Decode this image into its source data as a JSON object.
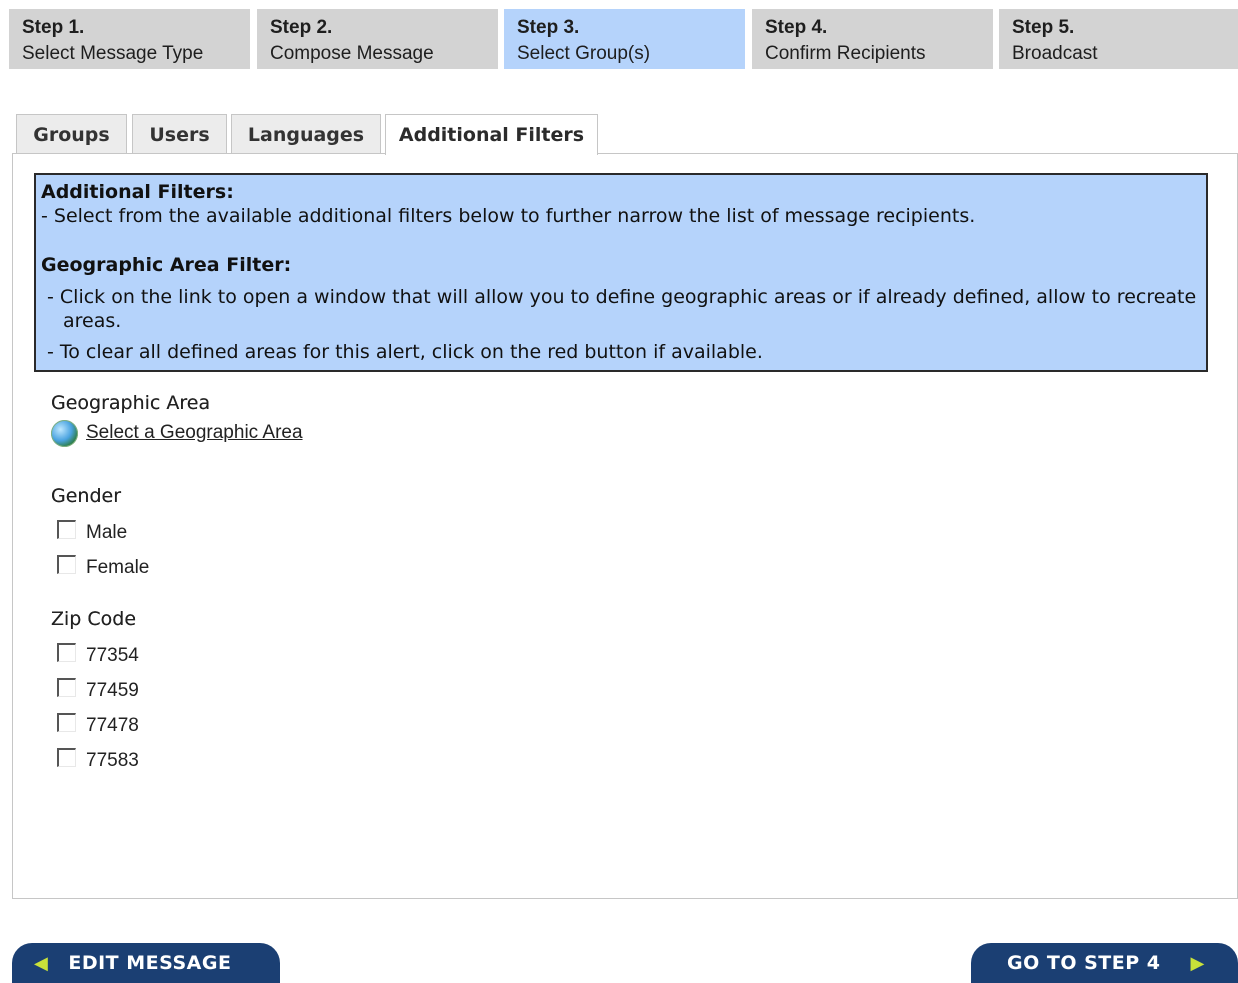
{
  "steps": [
    {
      "num": "Step 1.",
      "label": "Select Message Type",
      "active": false
    },
    {
      "num": "Step 2.",
      "label": "Compose Message",
      "active": false
    },
    {
      "num": "Step 3.",
      "label": "Select Group(s)",
      "active": true
    },
    {
      "num": "Step 4.",
      "label": "Confirm Recipients",
      "active": false
    },
    {
      "num": "Step 5.",
      "label": "Broadcast",
      "active": false
    }
  ],
  "tabs": [
    {
      "label": "Groups",
      "active": false
    },
    {
      "label": "Users",
      "active": false
    },
    {
      "label": "Languages",
      "active": false
    },
    {
      "label": "Additional Filters",
      "active": true
    }
  ],
  "info": {
    "title": "Additional Filters:",
    "desc": "- Select from the available additional filters below to further narrow the list of message recipients.",
    "geo_title": "Geographic Area Filter:",
    "geo_line1": "- Click on the link to open a window that will allow you to define geographic areas or if already defined, allow to recreate areas.",
    "geo_line2": "- To clear all defined areas for this alert, click on the red button if available."
  },
  "geographic": {
    "title": "Geographic Area",
    "link_label": "Select a Geographic Area",
    "icon": "globe-icon"
  },
  "gender": {
    "title": "Gender",
    "options": [
      {
        "label": "Male",
        "checked": false
      },
      {
        "label": "Female",
        "checked": false
      }
    ]
  },
  "zip": {
    "title": "Zip Code",
    "options": [
      {
        "label": "77354",
        "checked": false
      },
      {
        "label": "77459",
        "checked": false
      },
      {
        "label": "77478",
        "checked": false
      },
      {
        "label": "77583",
        "checked": false
      }
    ]
  },
  "buttons": {
    "back_label": "EDIT MESSAGE",
    "next_label": "GO TO STEP 4",
    "back_icon": "arrow-left-icon",
    "next_icon": "arrow-right-icon"
  },
  "colors": {
    "active_step": "#b5d3fb",
    "inactive_step": "#d3d3d3",
    "info_box": "#b5d3fb",
    "button": "#1b3f73",
    "arrow": "#c9e13a"
  }
}
